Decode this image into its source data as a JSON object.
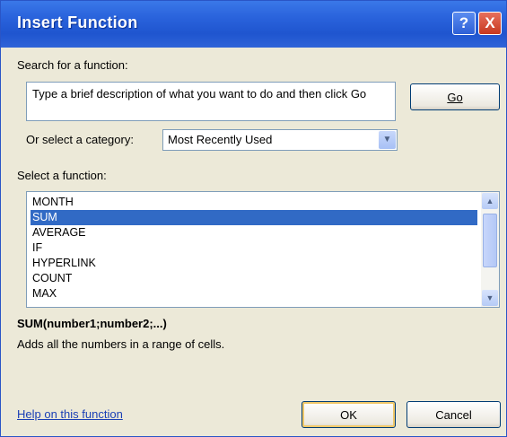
{
  "window": {
    "title": "Insert Function",
    "help_button": "?",
    "close_button": "X"
  },
  "search": {
    "label": "Search for a function:",
    "value": "Type a brief description of what you want to do and then click Go",
    "go_button": "Go"
  },
  "category": {
    "label": "Or select a category:",
    "selected": "Most Recently Used"
  },
  "functions": {
    "label": "Select a function:",
    "items": [
      "MONTH",
      "SUM",
      "AVERAGE",
      "IF",
      "HYPERLINK",
      "COUNT",
      "MAX"
    ],
    "selected_index": 1
  },
  "details": {
    "syntax": "SUM(number1;number2;...)",
    "description": "Adds all the numbers in a range of cells."
  },
  "footer": {
    "help_link": "Help on this function",
    "ok_button": "OK",
    "cancel_button": "Cancel"
  }
}
